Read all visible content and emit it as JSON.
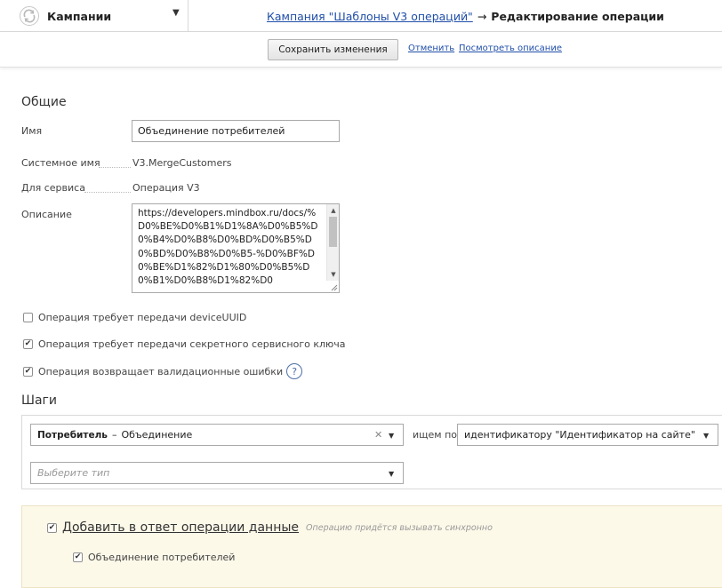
{
  "nav": {
    "section_label": "Кампании",
    "breadcrumb_link": "Кампания \"Шаблоны V3 операций\"",
    "breadcrumb_arrow": "→",
    "breadcrumb_current": "Редактирование операции"
  },
  "actions": {
    "save_label": "Сохранить изменения",
    "cancel_label": "Отменить",
    "view_description_label": "Посмотреть описание"
  },
  "general": {
    "title": "Общие",
    "name_label": "Имя",
    "name_value": "Объединение потребителей",
    "system_name_label": "Системное имя",
    "system_name_value": "V3.MergeCustomers",
    "service_label": "Для сервиса",
    "service_value": "Операция V3",
    "description_label": "Описание",
    "description_value": "https://developers.mindbox.ru/docs/%D0%BE%D0%B1%D1%8A%D0%B5%D0%B4%D0%B8%D0%BD%D0%B5%D0%BD%D0%B8%D0%B5-%D0%BF%D0%BE%D1%82%D1%80%D0%B5%D0%B1%D0%B8%D1%82%D0"
  },
  "options": [
    {
      "label": "Операция требует передачи deviceUUID",
      "checked": false
    },
    {
      "label": "Операция требует передачи секретного сервисного ключа",
      "checked": true
    },
    {
      "label": "Операция возвращает валидационные ошибки",
      "checked": true
    }
  ],
  "help_glyph": "?",
  "steps": {
    "title": "Шаги",
    "step_entity": "Потребитель",
    "step_dash": "–",
    "step_action": "Объединение",
    "search_by_label": "ищем по",
    "identifier_value": "идентификатору \"Идентификатор на сайте\"",
    "type_placeholder": "Выберите тип"
  },
  "response": {
    "add_data_label": "Добавить в ответ операции данные",
    "add_data_checked": true,
    "sync_note": "Операцию придётся вызывать синхронно",
    "item_label": "Объединение потребителей",
    "item_checked": true
  },
  "colors": {
    "link": "#1f4ea8",
    "response_bg": "#fdf9e9"
  }
}
